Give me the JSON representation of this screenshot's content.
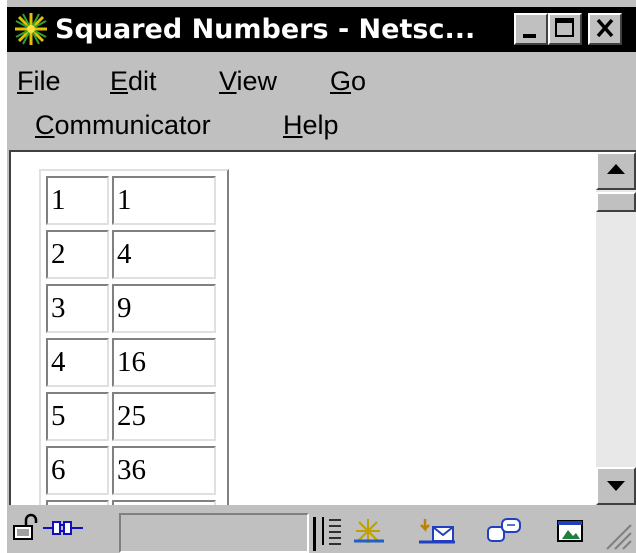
{
  "window": {
    "title": "Squared Numbers - Netsc...",
    "icon": "netscape-logo-icon",
    "controls": {
      "minimize_icon": "minimize-icon",
      "maximize_icon": "maximize-icon",
      "close_icon": "close-icon"
    }
  },
  "menubar": {
    "row1": [
      {
        "accel": "F",
        "rest": "ile"
      },
      {
        "accel": "E",
        "rest": "dit"
      },
      {
        "accel": "V",
        "rest": "iew"
      },
      {
        "accel": "G",
        "rest": "o"
      }
    ],
    "row2": [
      {
        "accel": "C",
        "rest": "ommunicator"
      },
      {
        "accel": "H",
        "rest": "elp"
      }
    ]
  },
  "table": {
    "rows": [
      [
        "1",
        "1"
      ],
      [
        "2",
        "4"
      ],
      [
        "3",
        "9"
      ],
      [
        "4",
        "16"
      ],
      [
        "5",
        "25"
      ],
      [
        "6",
        "36"
      ],
      [
        "",
        ""
      ]
    ]
  },
  "scrollbar": {
    "up_icon": "scroll-up-arrow-icon",
    "down_icon": "scroll-down-arrow-icon"
  },
  "statusbar": {
    "icons": [
      "security-lock-icon",
      "connection-plug-icon",
      "navigator-icon",
      "mail-icon",
      "discussion-icon",
      "composer-icon",
      "resize-grip-icon"
    ],
    "status_text": ""
  },
  "colors": {
    "titlebar_bg": "#000000",
    "chrome_bg": "#c0c0c0",
    "content_bg": "#ffffff"
  }
}
